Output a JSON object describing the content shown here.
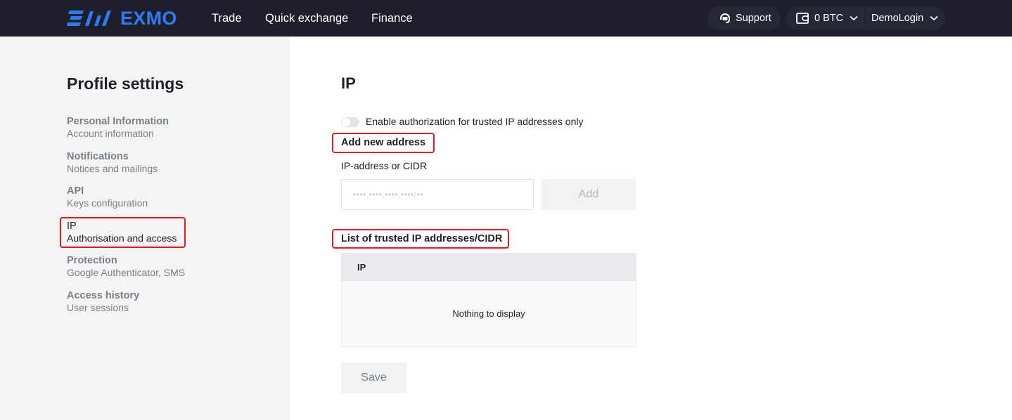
{
  "header": {
    "brand": "EXMO",
    "nav": [
      "Trade",
      "Quick exchange",
      "Finance"
    ],
    "support_label": "Support",
    "balance": "0 BTC",
    "user": "DemoLogin",
    "brand_color": "#2c7cf6",
    "icons": {
      "support": "headset-icon",
      "wallet": "wallet-icon",
      "chevron": "chevron-down-icon"
    }
  },
  "sidebar": {
    "title": "Profile settings",
    "items": [
      {
        "title": "Personal Information",
        "subtitle": "Account information"
      },
      {
        "title": "Notifications",
        "subtitle": "Notices and mailings"
      },
      {
        "title": "API",
        "subtitle": "Keys configuration"
      },
      {
        "title": "IP",
        "subtitle": "Authorisation and access",
        "active": true
      },
      {
        "title": "Protection",
        "subtitle": "Google Authenticator, SMS"
      },
      {
        "title": "Access history",
        "subtitle": "User sessions"
      }
    ]
  },
  "main": {
    "title": "IP",
    "toggle": {
      "label": "Enable authorization for trusted IP addresses only",
      "enabled": false
    },
    "add_section": {
      "heading": "Add new address",
      "field_label": "IP-address or CIDR",
      "placeholder": "••••.••••.••••.••••/••",
      "value": "",
      "add_label": "Add"
    },
    "list_section": {
      "heading": "List of trusted IP addresses/CIDR",
      "columns": [
        "IP"
      ],
      "rows": [],
      "empty_text": "Nothing to display"
    },
    "save_label": "Save"
  },
  "highlight_color": "#e21b23"
}
